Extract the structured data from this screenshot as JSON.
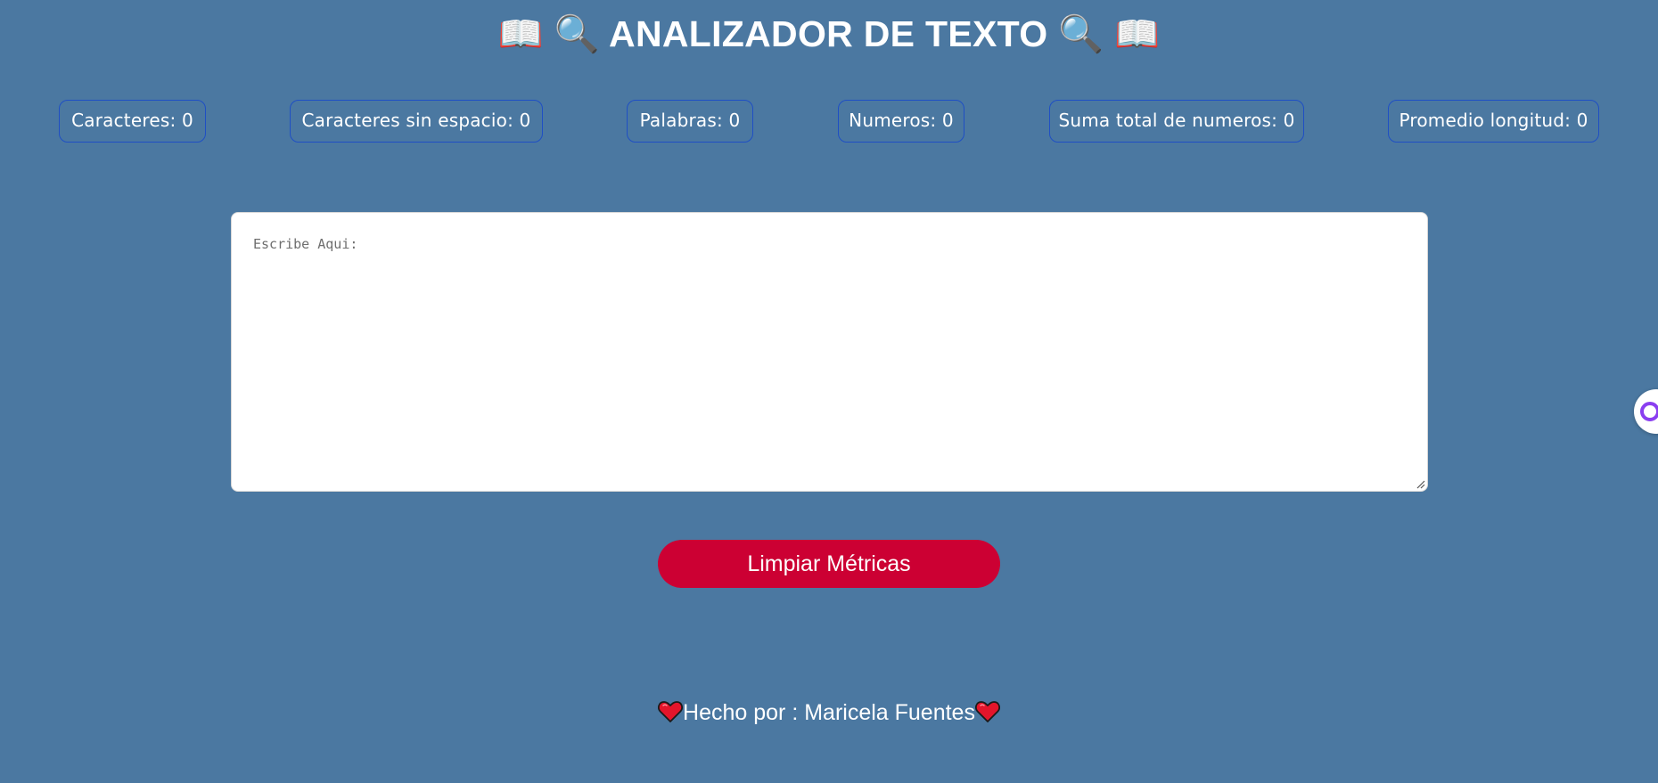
{
  "header": {
    "title_text": "ANALIZADOR DE TEXTO",
    "left_icons": [
      "open-book-icon",
      "magnifier-icon"
    ],
    "right_icons": [
      "magnifier-icon",
      "open-book-icon"
    ]
  },
  "metrics": [
    {
      "label": "Caracteres: 0"
    },
    {
      "label": "Caracteres sin espacio: 0"
    },
    {
      "label": "Palabras: 0"
    },
    {
      "label": "Numeros: 0"
    },
    {
      "label": "Suma total de numeros: 0"
    },
    {
      "label": "Promedio longitud: 0"
    }
  ],
  "editor": {
    "placeholder": "Escribe Aqui:",
    "value": ""
  },
  "actions": {
    "clear_label": "Limpiar Métricas"
  },
  "footer": {
    "credit": "Hecho por : Maricela Fuentes",
    "icon": "heart-icon"
  },
  "colors": {
    "background": "#4b78a1",
    "metric_border": "#1f4fc4",
    "button": "#cc0033",
    "text": "#ffffff"
  }
}
